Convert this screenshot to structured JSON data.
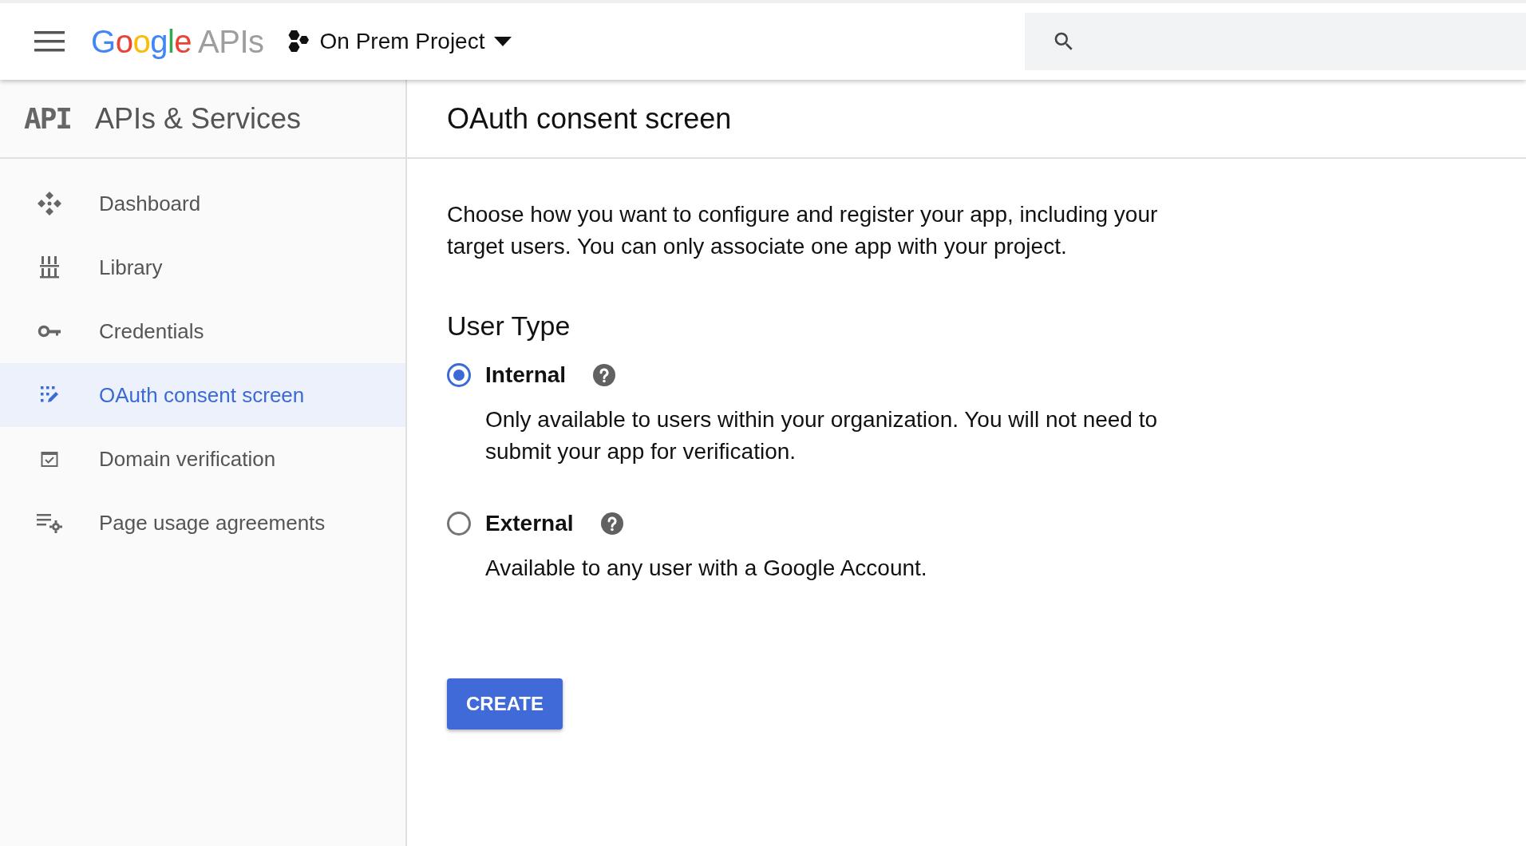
{
  "header": {
    "logo_brand": "Google",
    "logo_product": "APIs",
    "project": "On Prem Project"
  },
  "sidebar": {
    "logo": "API",
    "title": "APIs & Services",
    "items": [
      {
        "label": "Dashboard",
        "kind": "dashboard",
        "selected": false
      },
      {
        "label": "Library",
        "kind": "library",
        "selected": false
      },
      {
        "label": "Credentials",
        "kind": "credentials",
        "selected": false
      },
      {
        "label": "OAuth consent screen",
        "kind": "consent",
        "selected": true
      },
      {
        "label": "Domain verification",
        "kind": "domain",
        "selected": false
      },
      {
        "label": "Page usage agreements",
        "kind": "agreements",
        "selected": false
      }
    ]
  },
  "page": {
    "title": "OAuth consent screen",
    "intro": "Choose how you want to configure and register your app, including your target users. You can only associate one app with your project.",
    "section_title": "User Type",
    "options": [
      {
        "label": "Internal",
        "description": "Only available to users within your organization. You will not need to submit your app for verification.",
        "selected": true
      },
      {
        "label": "External",
        "description": "Available to any user with a Google Account.",
        "selected": false
      }
    ],
    "button": "CREATE"
  }
}
